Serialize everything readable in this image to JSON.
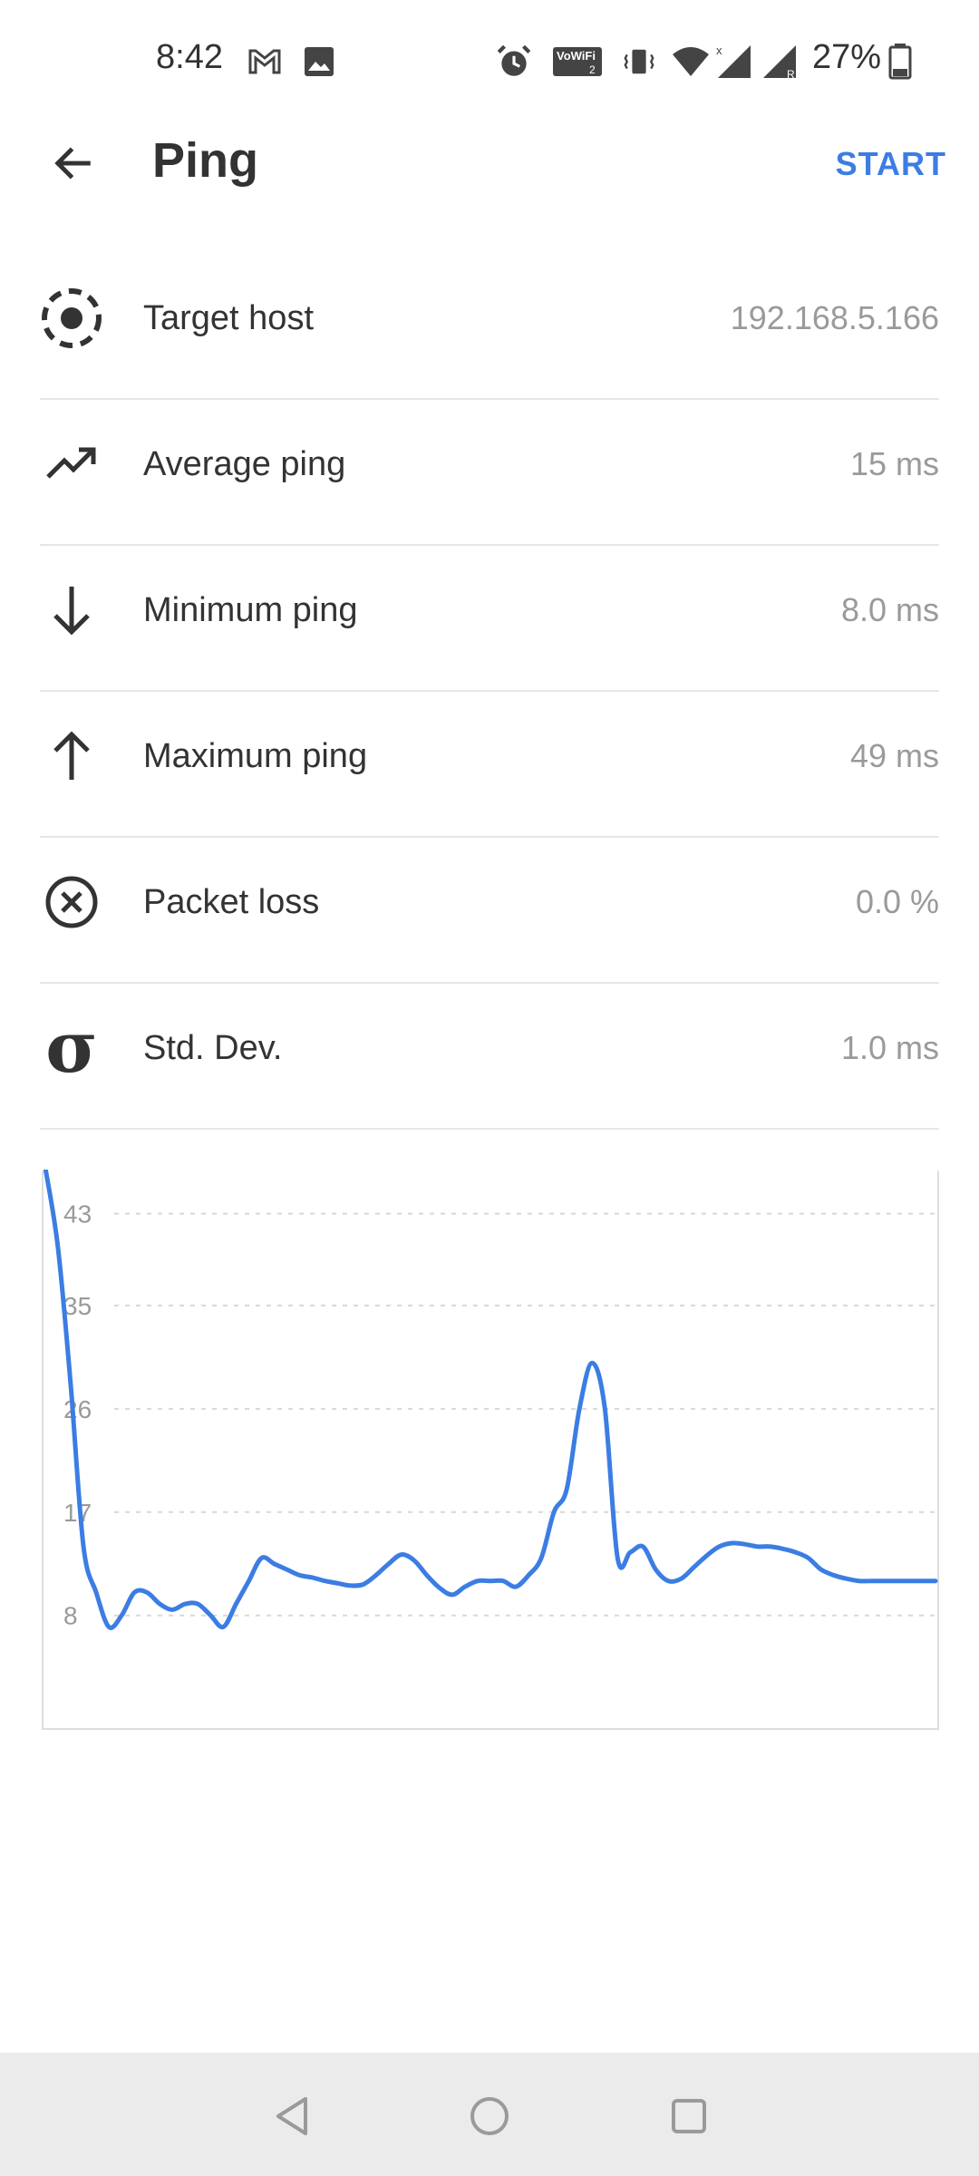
{
  "status_bar": {
    "time": "8:42",
    "battery": "27%",
    "icons": [
      "gmail-icon",
      "image-icon",
      "alarm-icon",
      "vowifi-icon",
      "vibrate-icon",
      "wifi-icon",
      "signal-icon",
      "signal-roaming-icon",
      "battery-icon"
    ]
  },
  "app_bar": {
    "title": "Ping",
    "start_label": "START"
  },
  "stats": [
    {
      "icon": "target-icon",
      "label": "Target host",
      "value": "192.168.5.166"
    },
    {
      "icon": "trending-up-icon",
      "label": "Average ping",
      "value": "15 ms"
    },
    {
      "icon": "arrow-down-icon",
      "label": "Minimum ping",
      "value": "8.0 ms"
    },
    {
      "icon": "arrow-up-icon",
      "label": "Maximum ping",
      "value": "49 ms"
    },
    {
      "icon": "cancel-circle-icon",
      "label": "Packet loss",
      "value": "0.0 %"
    },
    {
      "icon": "sigma-icon",
      "label": "Std. Dev.",
      "value": "1.0 ms",
      "glyph": "σ"
    }
  ],
  "chart_data": {
    "type": "line",
    "ylim": [
      0,
      49
    ],
    "y_ticks": [
      8,
      17,
      26,
      35,
      43
    ],
    "grid": true,
    "color": "#3b7de3",
    "x": [
      0,
      1,
      2,
      3,
      4,
      5,
      6,
      7,
      8,
      9,
      10,
      11,
      12,
      13,
      14,
      15,
      16,
      17,
      18,
      19,
      20,
      21,
      22,
      23,
      24,
      25,
      26,
      27,
      28,
      29,
      30,
      31,
      32,
      33,
      34,
      35,
      36,
      37,
      38,
      39,
      40,
      41,
      42,
      43,
      44,
      45,
      46,
      47,
      48,
      49,
      50,
      51,
      52,
      53,
      54,
      55,
      56,
      57,
      58,
      59,
      60,
      61,
      62,
      63,
      64,
      65,
      66,
      67,
      68,
      69,
      70
    ],
    "values": [
      47,
      40,
      28,
      14,
      10,
      7,
      8,
      10,
      10,
      9,
      8.5,
      9,
      9,
      8,
      7,
      9,
      11,
      13,
      12.5,
      12,
      11.5,
      11.3,
      11,
      10.8,
      10.6,
      10.7,
      11.5,
      12.5,
      13.3,
      12.8,
      11.5,
      10.4,
      9.8,
      10.5,
      11,
      11,
      11,
      10.5,
      11.5,
      13,
      17,
      19,
      26,
      30,
      26,
      13,
      13.5,
      14,
      12,
      11,
      11.2,
      12.2,
      13.2,
      14,
      14.3,
      14.2,
      14,
      14,
      13.8,
      13.5,
      13,
      12,
      11.5,
      11.2,
      11,
      11,
      11,
      11,
      11,
      11,
      11
    ]
  },
  "nav_bar": {
    "buttons": [
      "back-nav-icon",
      "home-nav-icon",
      "recents-nav-icon"
    ]
  }
}
